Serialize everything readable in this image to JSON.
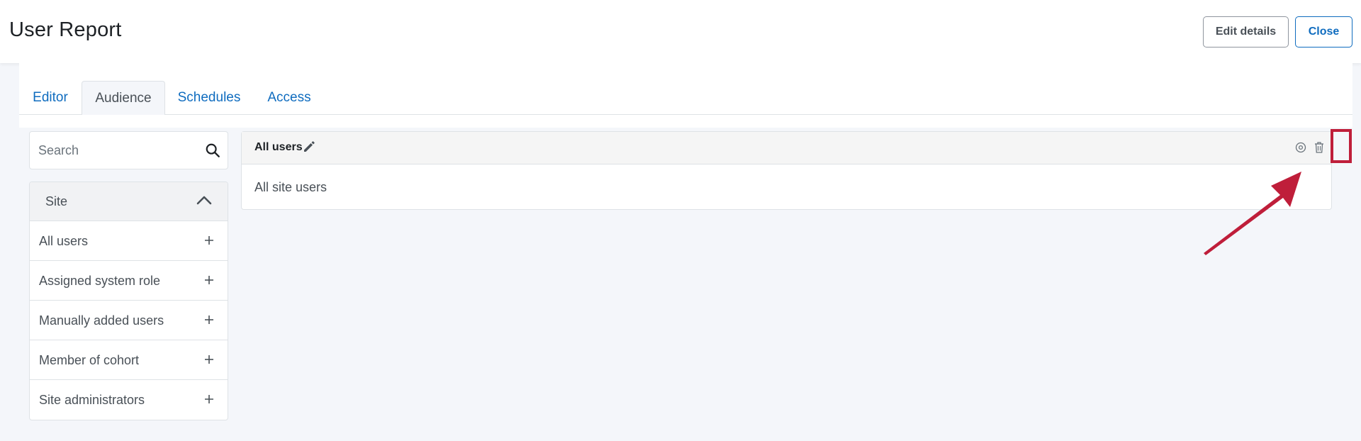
{
  "header": {
    "title": "User Report",
    "edit_label": "Edit details",
    "close_label": "Close"
  },
  "tabs": [
    {
      "label": "Editor",
      "active": false
    },
    {
      "label": "Audience",
      "active": true
    },
    {
      "label": "Schedules",
      "active": false
    },
    {
      "label": "Access",
      "active": false
    }
  ],
  "sidebar": {
    "search_placeholder": "Search",
    "section": {
      "label": "Site",
      "expanded": true,
      "items": [
        {
          "label": "All users"
        },
        {
          "label": "Assigned system role"
        },
        {
          "label": "Manually added users"
        },
        {
          "label": "Member of cohort"
        },
        {
          "label": "Site administrators"
        }
      ]
    }
  },
  "main": {
    "card": {
      "title": "All users",
      "body": "All site users"
    }
  },
  "icons": {
    "search": "search-icon",
    "chevron": "chevron-up-icon",
    "add": "plus-icon",
    "edit": "pencil-icon",
    "visibility": "visibility-icon",
    "delete": "trash-icon",
    "annotation": "arrow-icon"
  },
  "colors": {
    "accent": "#0f6cbf",
    "annotation": "#bf1e3a",
    "page_bg": "#f4f6fa"
  }
}
